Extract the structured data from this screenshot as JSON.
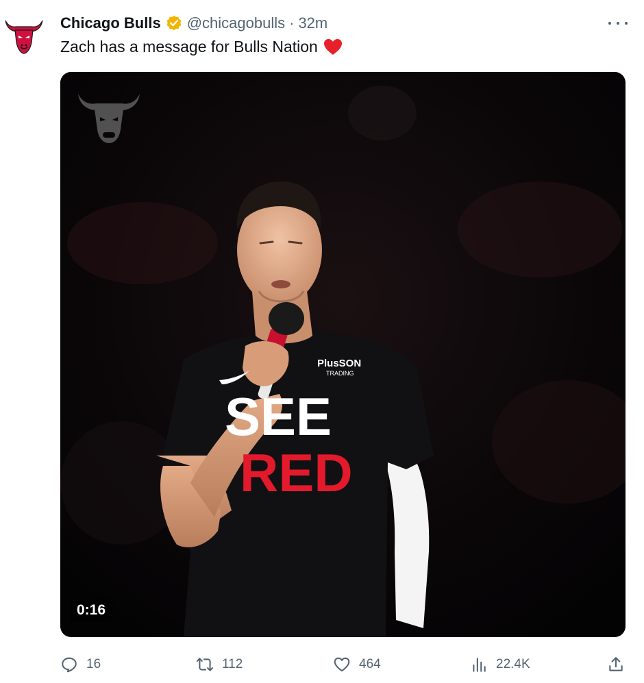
{
  "author": {
    "name": "Chicago Bulls",
    "handle": "@chicagobulls",
    "separator": "·",
    "time": "32m",
    "avatar_icon": "bull-logo-icon",
    "verified_icon": "verified-badge-icon",
    "verified_color": "#f4b400"
  },
  "tweet": {
    "text": "Zach has a message for Bulls Nation",
    "emoji_icon": "red-heart-icon"
  },
  "media": {
    "duration": "0:16",
    "shirt_text_top": "SEE",
    "shirt_text_bottom": "RED",
    "watermark_icon": "bull-logo-icon"
  },
  "actions": {
    "reply": {
      "icon": "reply-icon",
      "count": "16"
    },
    "retweet": {
      "icon": "retweet-icon",
      "count": "112"
    },
    "like": {
      "icon": "heart-icon",
      "count": "464"
    },
    "views": {
      "icon": "views-icon",
      "count": "22.4K"
    },
    "share": {
      "icon": "share-icon"
    }
  },
  "colors": {
    "text_primary": "#0f1419",
    "text_secondary": "#536471",
    "bulls_red": "#ce1141",
    "heart_red": "#e8202a"
  }
}
